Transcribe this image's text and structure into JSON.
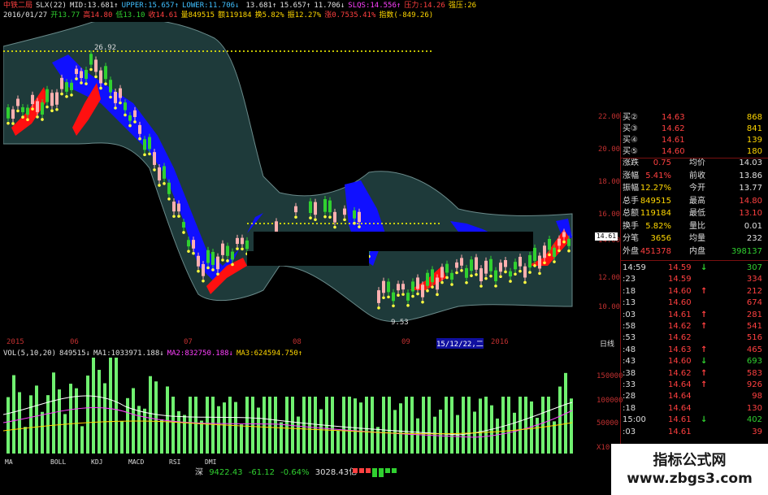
{
  "header": {
    "line1": [
      {
        "t": "中铁二局",
        "c": "r"
      },
      {
        "t": "SLX(22)",
        "c": "w"
      },
      {
        "t": "MID:13.681↑",
        "c": "w"
      },
      {
        "t": "UPPER:15.657↑",
        "c": "c"
      },
      {
        "t": "LOWER:11.706↓",
        "c": "c"
      },
      {
        "t": "",
        "c": "w"
      },
      {
        "t": "13.681↑",
        "c": "w"
      },
      {
        "t": "15.657↑",
        "c": "w"
      },
      {
        "t": "11.706↓",
        "c": "w"
      },
      {
        "t": "SLQS:14.556↑",
        "c": "m"
      },
      {
        "t": "压力:14.26",
        "c": "r"
      },
      {
        "t": "强压:26",
        "c": "y"
      }
    ],
    "line2": [
      {
        "t": "2016/01/27",
        "c": "w"
      },
      {
        "t": "开13.77",
        "c": "g"
      },
      {
        "t": "高14.80",
        "c": "r"
      },
      {
        "t": "低13.10",
        "c": "g"
      },
      {
        "t": "收14.61",
        "c": "r"
      },
      {
        "t": "量849515",
        "c": "y"
      },
      {
        "t": "额119184",
        "c": "y"
      },
      {
        "t": "换5.82%",
        "c": "y"
      },
      {
        "t": "振12.27%",
        "c": "y"
      },
      {
        "t": "涨0.7535.41%",
        "c": "r"
      },
      {
        "t": "指数(-849.26)",
        "c": "y"
      }
    ]
  },
  "price_axis": [
    "22.00",
    "20.00",
    "18.00",
    "16.00",
    "14.00",
    "12.00",
    "10.00"
  ],
  "price_marker": "14.61",
  "annotations": {
    "high": "26.92",
    "low": "9.53",
    "right1": "22",
    "right2": "00"
  },
  "date_axis": [
    {
      "label": "2015"
    },
    {
      "label": "06"
    },
    {
      "label": "07"
    },
    {
      "label": "08"
    },
    {
      "label": "09"
    },
    {
      "label": "15/12/22,二"
    },
    {
      "label": "2016"
    },
    {
      "label": "日线"
    }
  ],
  "vol_header": [
    {
      "t": "VOL(5,10,20)",
      "c": "w"
    },
    {
      "t": "849515↓",
      "c": "w"
    },
    {
      "t": "MA1:1033971.188↓",
      "c": "w"
    },
    {
      "t": "MA2:832750.188↓",
      "c": "m"
    },
    {
      "t": "MA3:624594.750↑",
      "c": "y"
    }
  ],
  "vol_axis": [
    "150000",
    "100000",
    "50000",
    "X10"
  ],
  "tabs": [
    "MA",
    "BOLL",
    "KDJ",
    "MACD",
    "RSI",
    "DMI"
  ],
  "index_bar": {
    "name": "深",
    "value": "9422.43",
    "change": "-61.12",
    "pct": "-0.64%",
    "amount": "3028.43亿"
  },
  "quotes": {
    "bids": [
      {
        "label": "买②",
        "price": "14.63",
        "vol": "868"
      },
      {
        "label": "买③",
        "price": "14.62",
        "vol": "841"
      },
      {
        "label": "买④",
        "price": "14.61",
        "vol": "139"
      },
      {
        "label": "买⑤",
        "price": "14.60",
        "vol": "180"
      }
    ],
    "stats": [
      {
        "l1": "涨跌",
        "v1": "0.75",
        "l2": "均价",
        "v2": "14.03"
      },
      {
        "l1": "涨幅",
        "v1": "5.41%",
        "l2": "前收",
        "v2": "13.86"
      },
      {
        "l1": "振幅",
        "v1": "12.27%",
        "l2": "今开",
        "v2": "13.77"
      },
      {
        "l1": "总手",
        "v1": "849515",
        "l2": "最高",
        "v2": "14.80"
      },
      {
        "l1": "总额",
        "v1": "119184",
        "l2": "最低",
        "v2": "13.10"
      },
      {
        "l1": "换手",
        "v1": "5.82%",
        "l2": "量比",
        "v2": "0.01"
      },
      {
        "l1": "分笔",
        "v1": "3656",
        "l2": "均量",
        "v2": "232"
      },
      {
        "l1": "外盘",
        "v1": "451378",
        "l2": "内盘",
        "v2": "398137"
      }
    ],
    "ticks": [
      {
        "t": "14:59",
        "p": "14.59",
        "d": "down",
        "v": "307"
      },
      {
        "t": ":23",
        "p": "14.59",
        "d": "",
        "v": "334"
      },
      {
        "t": ":18",
        "p": "14.60",
        "d": "up",
        "v": "212"
      },
      {
        "t": ":13",
        "p": "14.60",
        "d": "",
        "v": "674"
      },
      {
        "t": ":03",
        "p": "14.61",
        "d": "up",
        "v": "281"
      },
      {
        "t": ":58",
        "p": "14.62",
        "d": "up",
        "v": "541"
      },
      {
        "t": ":53",
        "p": "14.62",
        "d": "",
        "v": "516"
      },
      {
        "t": ":48",
        "p": "14.63",
        "d": "up",
        "v": "465"
      },
      {
        "t": ":43",
        "p": "14.60",
        "d": "down",
        "v": "693"
      },
      {
        "t": ":38",
        "p": "14.62",
        "d": "up",
        "v": "583"
      },
      {
        "t": ":33",
        "p": "14.64",
        "d": "up",
        "v": "926"
      },
      {
        "t": ":28",
        "p": "14.64",
        "d": "",
        "v": "98"
      },
      {
        "t": ":18",
        "p": "14.64",
        "d": "",
        "v": "130"
      },
      {
        "t": "15:00",
        "p": "14.61",
        "d": "down",
        "v": "402"
      },
      {
        "t": ":03",
        "p": "14.61",
        "d": "",
        "v": "39"
      }
    ]
  },
  "watermark": {
    "title": "指标公式网",
    "url": "www.zbgs3.com"
  }
}
